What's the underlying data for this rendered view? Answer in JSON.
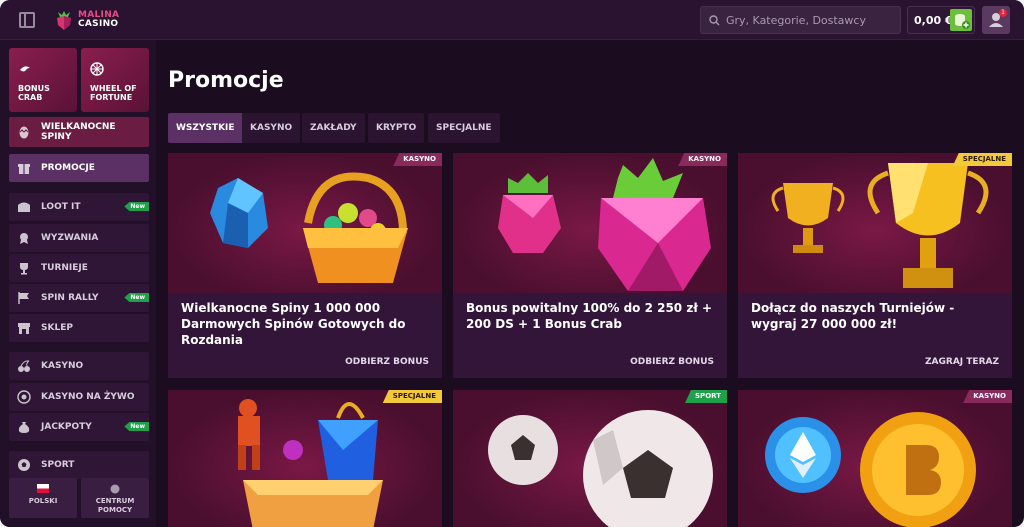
{
  "header": {
    "logo_line1": "MALINA",
    "logo_line2": "CASINO",
    "search_placeholder": "Gry, Kategorie, Dostawcy",
    "balance": "0,00 €",
    "notification_count": "1"
  },
  "sidebar": {
    "tiles": [
      {
        "label1": "BONUS",
        "label2": "CRAB"
      },
      {
        "label1": "WHEEL OF",
        "label2": "FORTUNE"
      }
    ],
    "easter": "WIELKANOCNE SPINY",
    "items": [
      {
        "label": "PROMOCJE",
        "badge": ""
      },
      {
        "label": "LOOT IT",
        "badge": "New"
      },
      {
        "label": "WYZWANIA",
        "badge": ""
      },
      {
        "label": "TURNIEJE",
        "badge": ""
      },
      {
        "label": "SPIN RALLY",
        "badge": "New"
      },
      {
        "label": "SKLEP",
        "badge": ""
      },
      {
        "label": "KASYNO",
        "badge": ""
      },
      {
        "label": "KASYNO NA ŻYWO",
        "badge": ""
      },
      {
        "label": "JACKPOTY",
        "badge": "New"
      },
      {
        "label": "SPORT",
        "badge": ""
      }
    ],
    "language": "POLSKI",
    "help_line1": "CENTRUM",
    "help_line2": "POMOCY"
  },
  "main": {
    "title": "Promocje",
    "tabs": [
      "WSZYSTKIE",
      "KASYNO",
      "ZAKŁADY",
      "KRYPTO",
      "SPECJALNE"
    ],
    "cards": [
      {
        "tag": "KASYNO",
        "title": "Wielkanocne Spiny 1 000 000 Darmowych Spinów Gotowych do Rozdania",
        "cta": "ODBIERZ BONUS"
      },
      {
        "tag": "KASYNO",
        "title": "Bonus powitalny 100% do 2 250 zł + 200 DS + 1 Bonus Crab",
        "cta": "ODBIERZ BONUS"
      },
      {
        "tag": "SPECJALNE",
        "title": "Dołącz do naszych Turniejów - wygraj 27 000 000 zł!",
        "cta": "ZAGRAJ TERAZ"
      },
      {
        "tag": "SPECJALNE",
        "title": "",
        "cta": ""
      },
      {
        "tag": "SPORT",
        "title": "",
        "cta": ""
      },
      {
        "tag": "KASYNO",
        "title": "",
        "cta": ""
      }
    ]
  },
  "colors": {
    "background": "#1b0d1f",
    "accent_green": "#1fa04a",
    "accent_yellow": "#f3c93c",
    "accent_pink": "#8a2a5c"
  }
}
